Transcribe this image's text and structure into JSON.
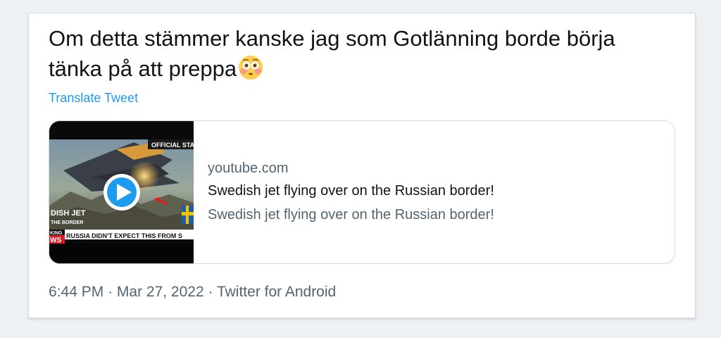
{
  "tweet": {
    "text": "Om detta stämmer kanske jag som Gotlänning borde börja tänka på att preppa",
    "emoji": "flushed-face-emoji",
    "translate_label": "Translate Tweet"
  },
  "link_card": {
    "domain": "youtube.com",
    "title": "Swedish jet flying over on the Russian border!",
    "description": "Swedish jet flying over on the Russian border!",
    "thumbnail": {
      "badge": "OFFICIAL STAT",
      "caption_line1": "DISH JET",
      "caption_line2": "THE BORDER",
      "tag_top": "KING",
      "tag_bottom": "WS",
      "ticker": "RUSSIA DIDN'T EXPECT THIS FROM S",
      "play_icon": "play-button-icon"
    }
  },
  "meta": {
    "time": "6:44 PM",
    "separator": "·",
    "date": "Mar 27, 2022",
    "source": "Twitter for Android"
  },
  "colors": {
    "link": "#1d9bf0",
    "text": "#0f1419",
    "secondary": "#536471",
    "page_bg": "#eef1f4"
  }
}
